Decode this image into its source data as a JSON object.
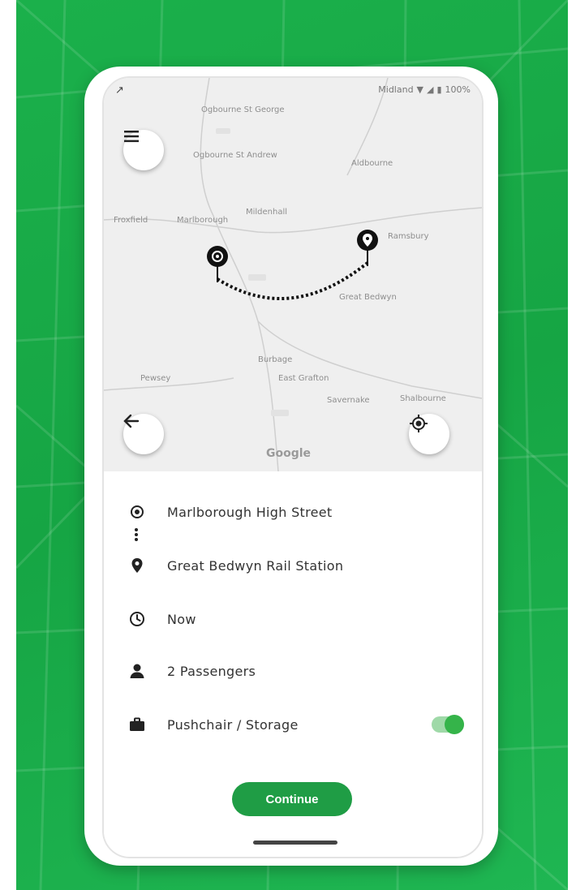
{
  "status_bar": {
    "carrier": "Midland",
    "battery": "100%"
  },
  "map": {
    "labels": [
      "Ogbourne St George",
      "Ogbourne St Andrew",
      "Aldbourne",
      "Marlborough",
      "Mildenhall",
      "Ramsbury",
      "Froxfield",
      "Great Bedwyn",
      "Burbage",
      "East Grafton",
      "Savernake",
      "Shalbourne",
      "Pewsey"
    ],
    "attribution": "Google"
  },
  "trip": {
    "origin": "Marlborough High Street",
    "destination": "Great Bedwyn Rail Station",
    "time": "Now",
    "passengers": "2 Passengers",
    "storage": "Pushchair / Storage",
    "storage_enabled": true
  },
  "actions": {
    "continue_label": "Continue"
  },
  "colors": {
    "background_green": "#1bb04b",
    "button_green": "#1f9d45",
    "toggle_green": "#35b44a"
  }
}
